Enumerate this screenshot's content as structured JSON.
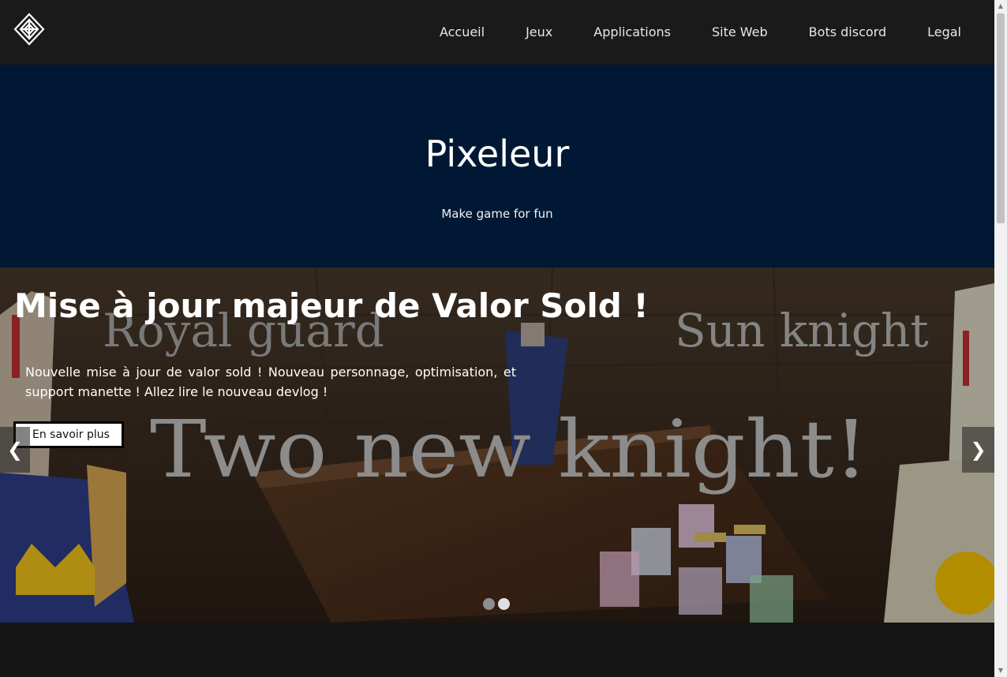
{
  "nav": {
    "logo": "logo-icon",
    "links": [
      "Accueil",
      "Jeux",
      "Applications",
      "Site Web",
      "Bots discord",
      "Legal"
    ]
  },
  "hero": {
    "title": "Pixeleur",
    "subtitle": "Make game for fun"
  },
  "carousel": {
    "image_text": {
      "left_caption": "Royal guard",
      "right_caption": "Sun knight",
      "main_caption": "Two new knight!"
    },
    "title": "Mise à jour majeur de Valor Sold !",
    "text": "Nouvelle mise à jour de valor sold ! Nouveau personnage, optimisation, et support manette ! Allez lire le nouveau devlog !",
    "button": "En savoir plus",
    "prev": "❮",
    "next": "❯",
    "active_slide": 2,
    "slide_count": 2
  },
  "colors": {
    "navbar": "#1a1a1a",
    "hero": "#001833",
    "page": "#151515"
  }
}
